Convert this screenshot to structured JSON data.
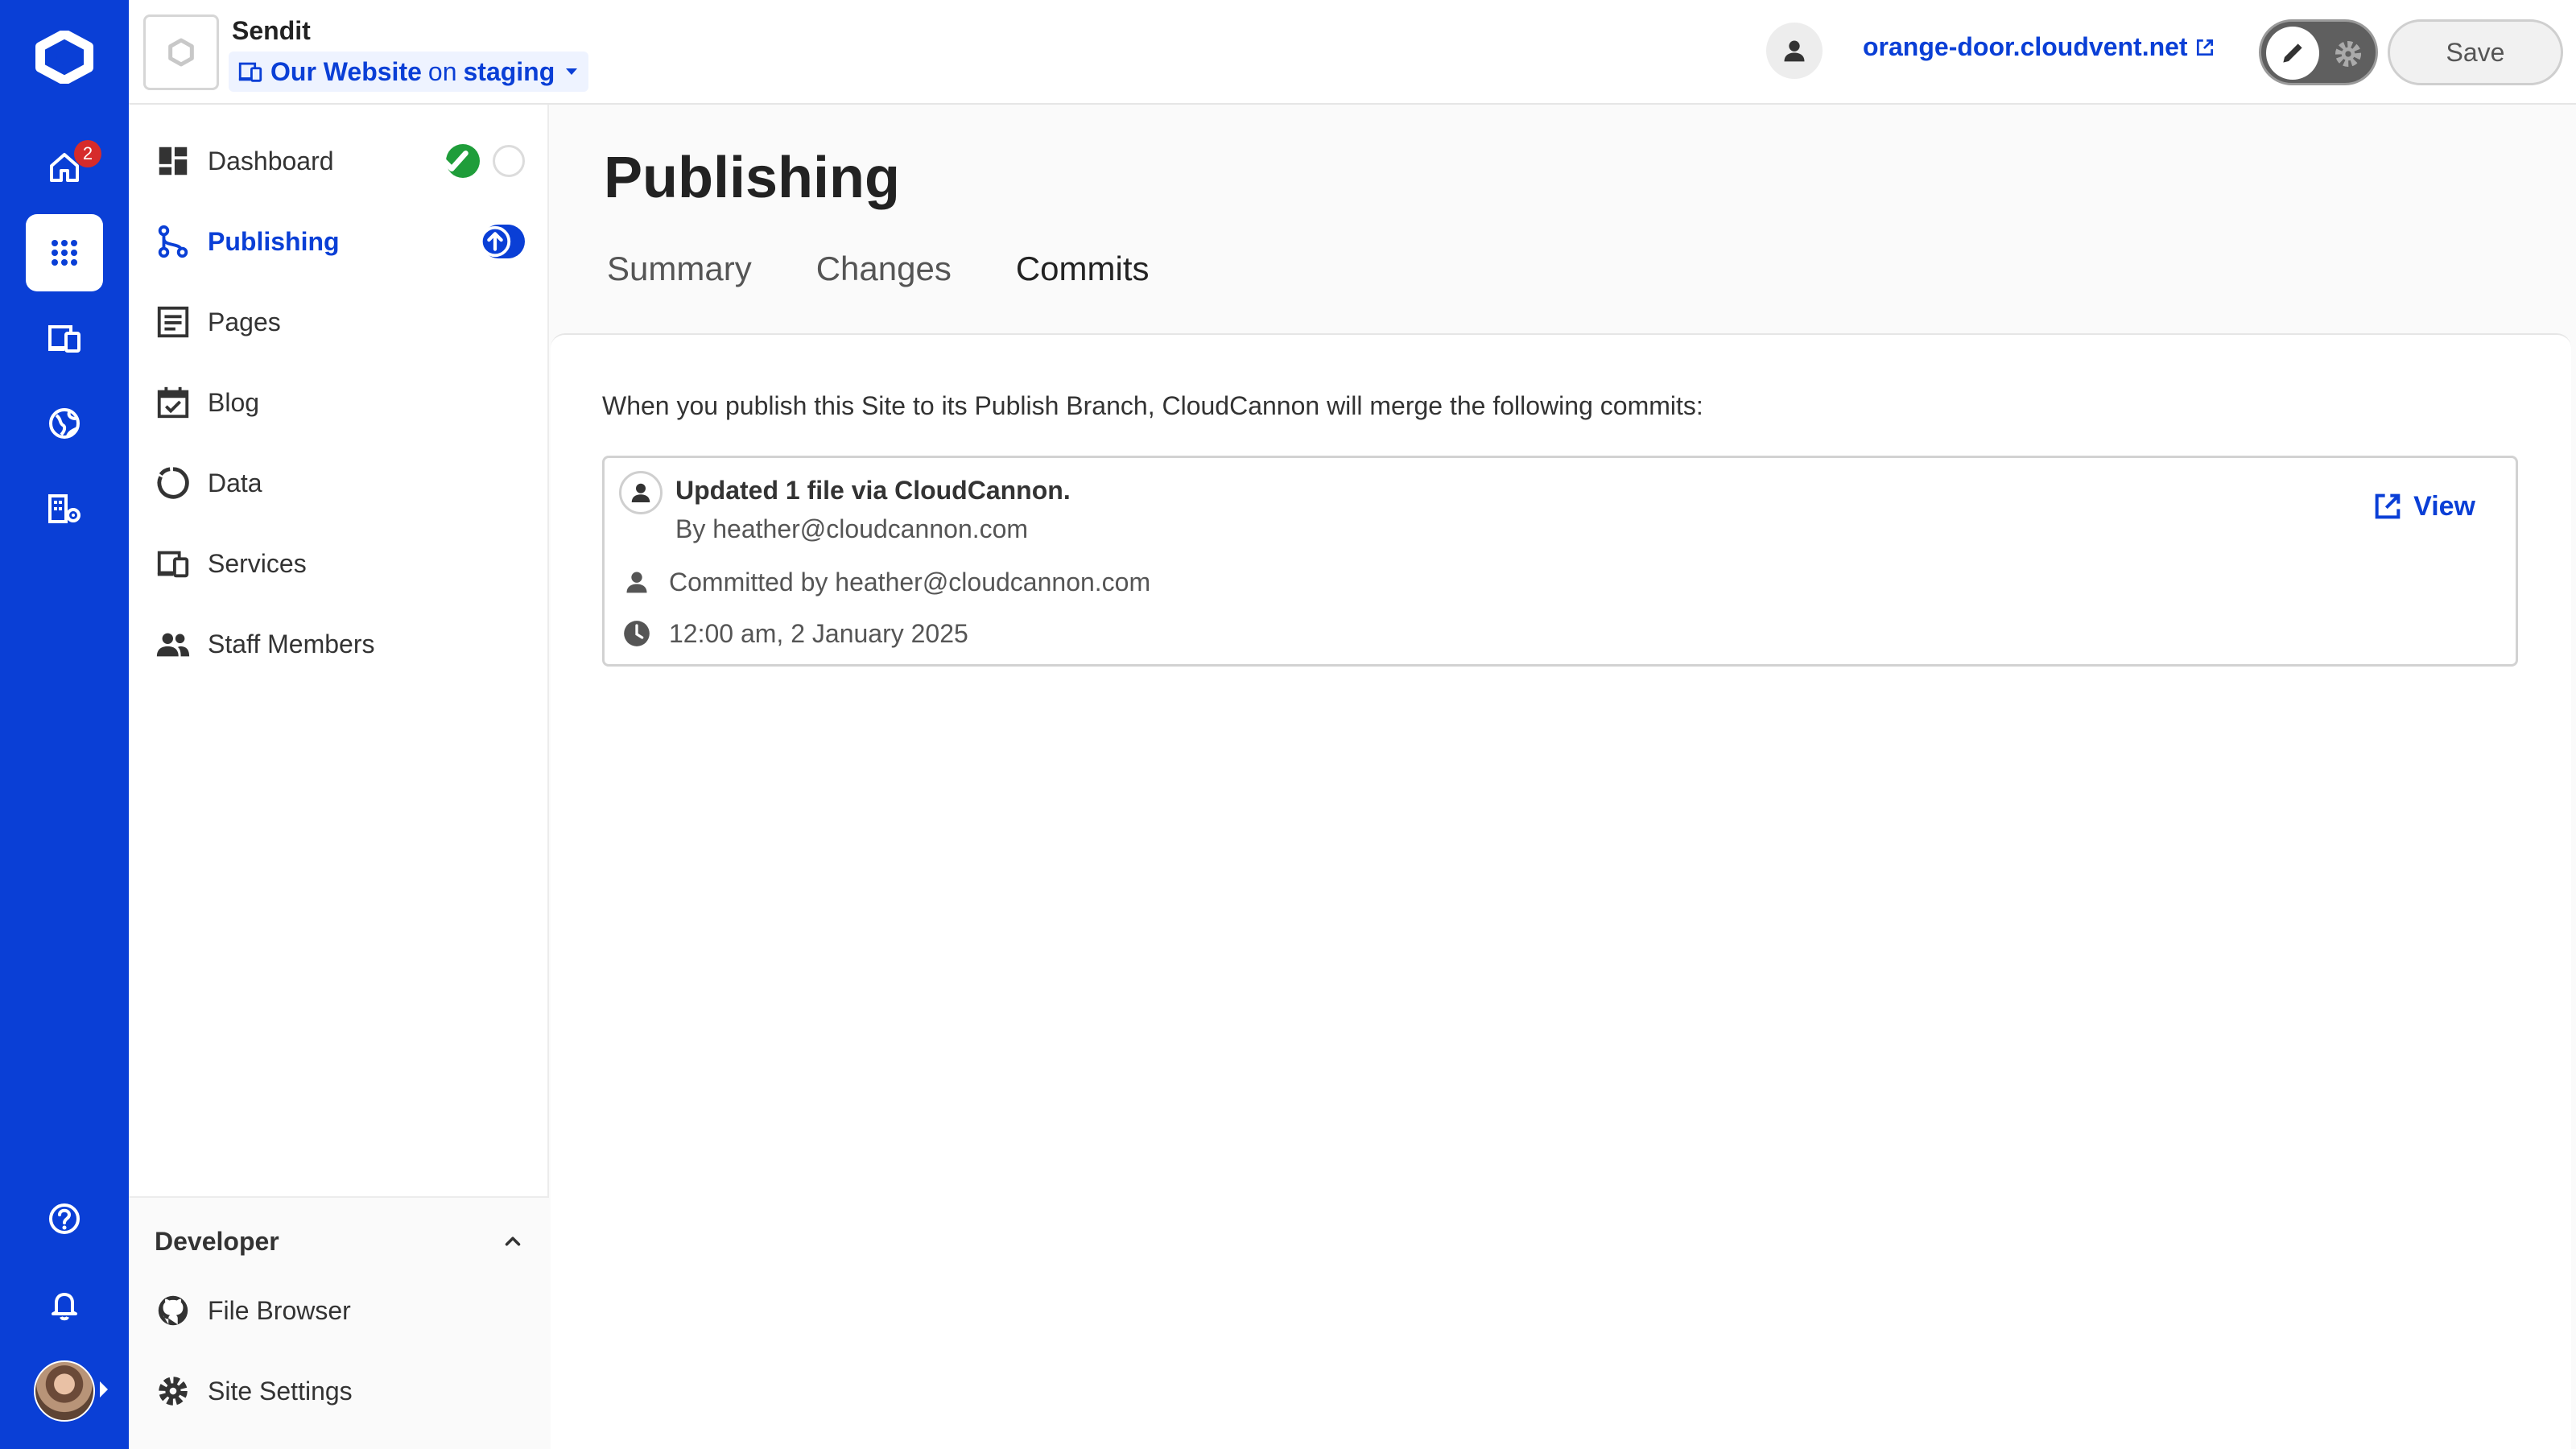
{
  "rail": {
    "home_badge": "2",
    "items": [
      "home-icon",
      "apps-grid-icon",
      "devices-icon",
      "globe-icon",
      "org-settings-icon"
    ],
    "bottom_items": [
      "help-icon",
      "bell-icon"
    ]
  },
  "header": {
    "site_name": "Sendit",
    "site_link": "Our Website",
    "on_text": "on",
    "branch": "staging",
    "domain": "orange-door.cloudvent.net",
    "save_label": "Save"
  },
  "sidebar": {
    "items": [
      {
        "label": "Dashboard",
        "icon": "dashboard-icon"
      },
      {
        "label": "Publishing",
        "icon": "branch-icon",
        "active": true
      },
      {
        "label": "Pages",
        "icon": "pages-icon"
      },
      {
        "label": "Blog",
        "icon": "calendar-check-icon"
      },
      {
        "label": "Data",
        "icon": "data-icon"
      },
      {
        "label": "Services",
        "icon": "services-icon"
      },
      {
        "label": "Staff Members",
        "icon": "people-icon"
      }
    ],
    "developer": {
      "label": "Developer",
      "items": [
        {
          "label": "File Browser",
          "icon": "github-icon"
        },
        {
          "label": "Site Settings",
          "icon": "gear-icon"
        }
      ]
    }
  },
  "main": {
    "title": "Publishing",
    "tabs": [
      "Summary",
      "Changes",
      "Commits"
    ],
    "active_tab": "Commits",
    "intro": "When you publish this Site to its Publish Branch, CloudCannon will merge the following commits:",
    "commits": [
      {
        "message": "Updated 1 file via CloudCannon.",
        "author": "By heather@cloudcannon.com",
        "committer": "Committed by heather@cloudcannon.com",
        "time": "12:00 am, 2 January 2025",
        "view_label": "View"
      }
    ]
  },
  "colors": {
    "brand": "#0a3fd6",
    "success": "#1f9d3a",
    "badge": "#d62b2b"
  }
}
